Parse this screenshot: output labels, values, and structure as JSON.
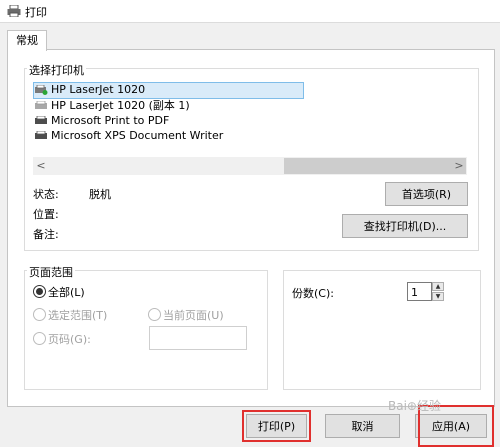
{
  "window": {
    "title": "打印"
  },
  "tabs": [
    {
      "label": "常规"
    }
  ],
  "printer_group": {
    "label": "选择打印机",
    "printers": [
      {
        "name": "HP LaserJet 1020",
        "selected": true
      },
      {
        "name": "HP LaserJet 1020 (副本 1)"
      },
      {
        "name": "Microsoft Print to PDF"
      },
      {
        "name": "Microsoft XPS Document Writer"
      }
    ],
    "status_label": "状态:",
    "status_value": "脱机",
    "location_label": "位置:",
    "comment_label": "备注:",
    "preferences_button": "首选项(R)",
    "find_printer_button": "查找打印机(D)..."
  },
  "page_range": {
    "label": "页面范围",
    "all": "全部(L)",
    "selection": "选定范围(T)",
    "current_page": "当前页面(U)",
    "pages": "页码(G):",
    "pages_value": ""
  },
  "copies": {
    "label": "份数(C):",
    "value": "1"
  },
  "buttons": {
    "print": "打印(P)",
    "cancel": "取消",
    "apply": "应用(A)"
  },
  "watermark": {
    "text": "Bai⊕经验"
  },
  "colors": {
    "highlight_red": "#e0302e",
    "selection_bg": "#d9ebf9",
    "selection_border": "#7fbde9"
  }
}
